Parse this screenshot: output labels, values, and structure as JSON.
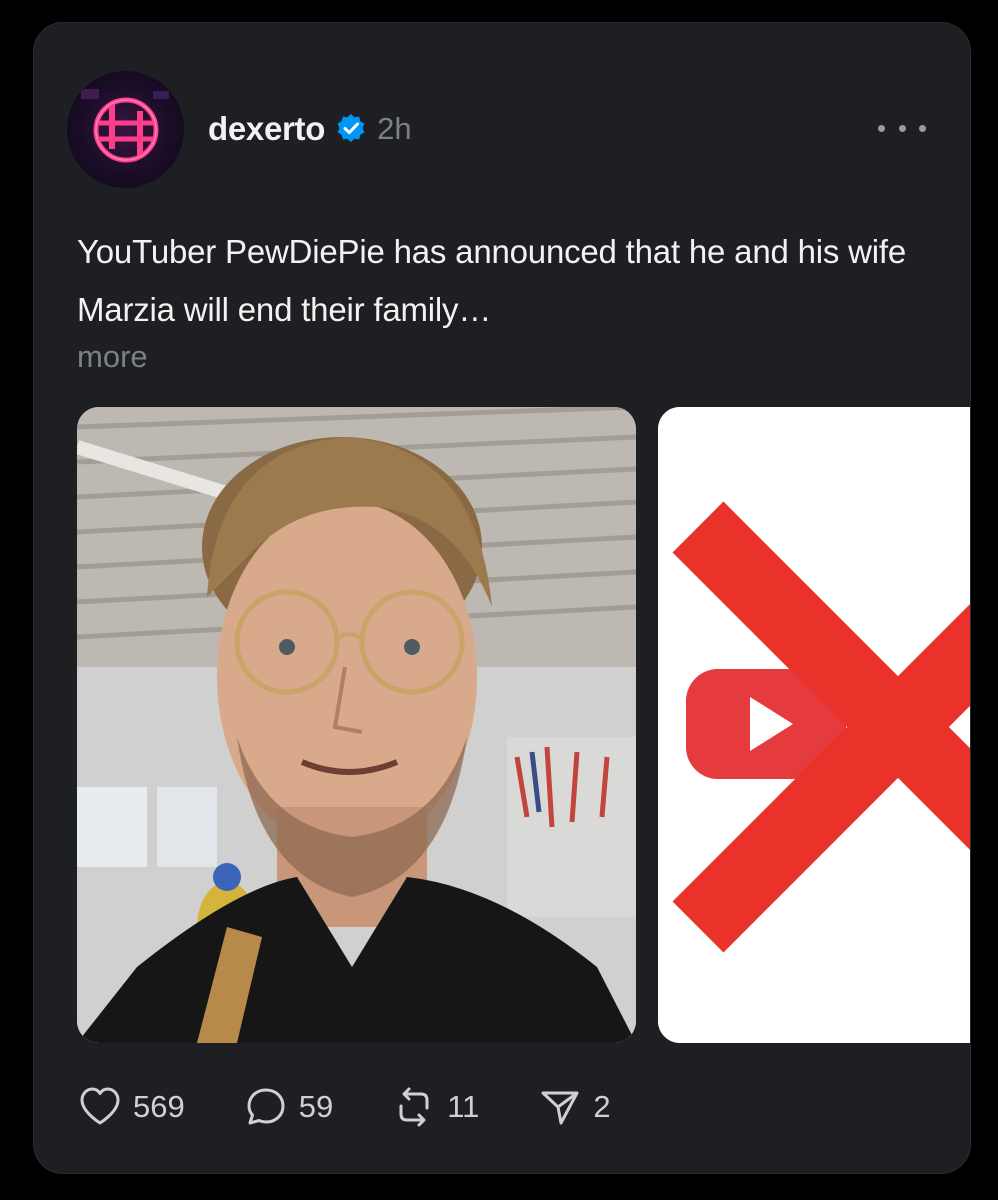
{
  "post": {
    "author": "dexerto",
    "verified": true,
    "timestamp": "2h",
    "text": "YouTuber PewDiePie has announced that he and his wife Marzia will end their family…",
    "more_label": "more"
  },
  "media": [
    {
      "icon": "person-selfie-photo"
    },
    {
      "icon": "youtube-logo-crossed-out"
    }
  ],
  "actions": {
    "likes": "569",
    "replies": "59",
    "reposts": "11",
    "shares": "2"
  },
  "colors": {
    "background": "#000000",
    "card": "#1e1f23",
    "text": "#f2f2f2",
    "muted": "#7d7f86",
    "verified_blue": "#0095f6",
    "youtube_red": "#e53b3f",
    "cross_red": "#e8322a",
    "avatar_neon": "#ff3d8b"
  }
}
